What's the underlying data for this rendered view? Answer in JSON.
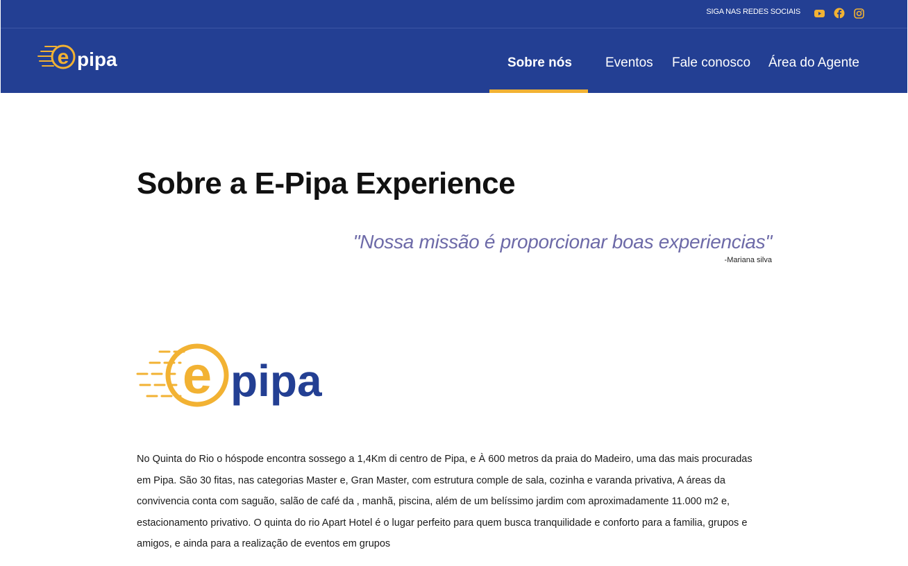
{
  "colors": {
    "header_bg": "#233f93",
    "accent_yellow": "#f2b233",
    "quote_color": "#6d6aa8"
  },
  "topbar": {
    "social_label": "SIGA NAS REDES SOCIAIS",
    "icons": [
      "youtube-icon",
      "facebook-icon",
      "instagram-icon"
    ]
  },
  "brand": {
    "logo_text": "pipa"
  },
  "nav": {
    "items": [
      "Sobre nós",
      "Eventos",
      "Fale conosco",
      "Área do Agente"
    ],
    "active": "Sobre nós"
  },
  "main": {
    "title": "Sobre a E-Pipa Experience",
    "quote": "\"Nossa missão é proporcionar boas experiencias\"",
    "quote_author": "-Mariana silva",
    "description": "No Quinta do Rio o hóspode encontra sossego a 1,4Km di centro de Pipa, e À 600 metros da praia do Madeiro, uma das mais procuradas em Pipa. São 30 fitas, nas categorias Master e, Gran Master, com estrutura comple de sala, cozinha e varanda privativa, A áreas da convivencia conta com saguão, salão de café da , manhã, piscina, além de um belíssimo jardim com aproximadamente 11.000 m2 e, estacionamento privativo. O quinta do rio Apart Hotel é o lugar perfeito para quem busca tranquilidade e conforto para a familia, grupos e amigos, e ainda para a realização de eventos em grupos"
  }
}
